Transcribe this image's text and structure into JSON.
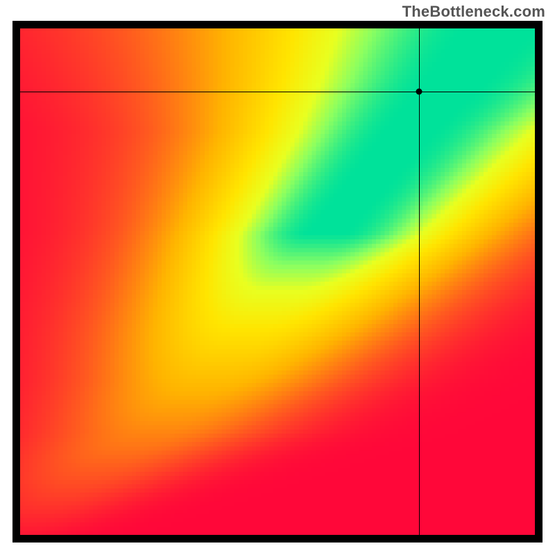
{
  "watermark": "TheBottleneck.com",
  "chart_data": {
    "type": "heatmap",
    "title": "",
    "xlabel": "",
    "ylabel": "",
    "xlim": [
      0,
      1
    ],
    "ylim": [
      0,
      1
    ],
    "grid_size": 120,
    "ridge": {
      "comment": "Approximate x-position of the green optimal ridge as a function of y (normalized 0..1, y=0 bottom). Piecewise control points.",
      "points": [
        {
          "y": 0.0,
          "x": 0.0
        },
        {
          "y": 0.05,
          "x": 0.05
        },
        {
          "y": 0.1,
          "x": 0.11
        },
        {
          "y": 0.15,
          "x": 0.18
        },
        {
          "y": 0.2,
          "x": 0.26
        },
        {
          "y": 0.3,
          "x": 0.36
        },
        {
          "y": 0.4,
          "x": 0.44
        },
        {
          "y": 0.5,
          "x": 0.52
        },
        {
          "y": 0.6,
          "x": 0.6
        },
        {
          "y": 0.7,
          "x": 0.68
        },
        {
          "y": 0.8,
          "x": 0.76
        },
        {
          "y": 0.9,
          "x": 0.85
        },
        {
          "y": 1.0,
          "x": 0.93
        }
      ]
    },
    "ridge_half_width": {
      "comment": "Approximate half-width of the bright-green band at each y.",
      "points": [
        {
          "y": 0.0,
          "w": 0.005
        },
        {
          "y": 0.1,
          "w": 0.012
        },
        {
          "y": 0.2,
          "w": 0.018
        },
        {
          "y": 0.4,
          "w": 0.025
        },
        {
          "y": 0.6,
          "w": 0.03
        },
        {
          "y": 0.8,
          "w": 0.04
        },
        {
          "y": 1.0,
          "w": 0.06
        }
      ]
    },
    "crosshair": {
      "x": 0.775,
      "y": 0.875
    },
    "colormap": {
      "comment": "value 0 = worst (red), 1 = best (green). Stops approximate the rendered gradient.",
      "stops": [
        {
          "v": 0.0,
          "color": "#ff0739"
        },
        {
          "v": 0.25,
          "color": "#ff5a1f"
        },
        {
          "v": 0.5,
          "color": "#ffb400"
        },
        {
          "v": 0.7,
          "color": "#ffe500"
        },
        {
          "v": 0.82,
          "color": "#e8ff20"
        },
        {
          "v": 0.9,
          "color": "#8cff60"
        },
        {
          "v": 1.0,
          "color": "#00e29a"
        }
      ]
    },
    "corner_values": {
      "comment": "Estimated heatmap values at the four corners (0=red,1=green).",
      "bottom_left": 0.02,
      "bottom_right": 0.0,
      "top_left": 0.0,
      "top_right": 0.72
    }
  }
}
